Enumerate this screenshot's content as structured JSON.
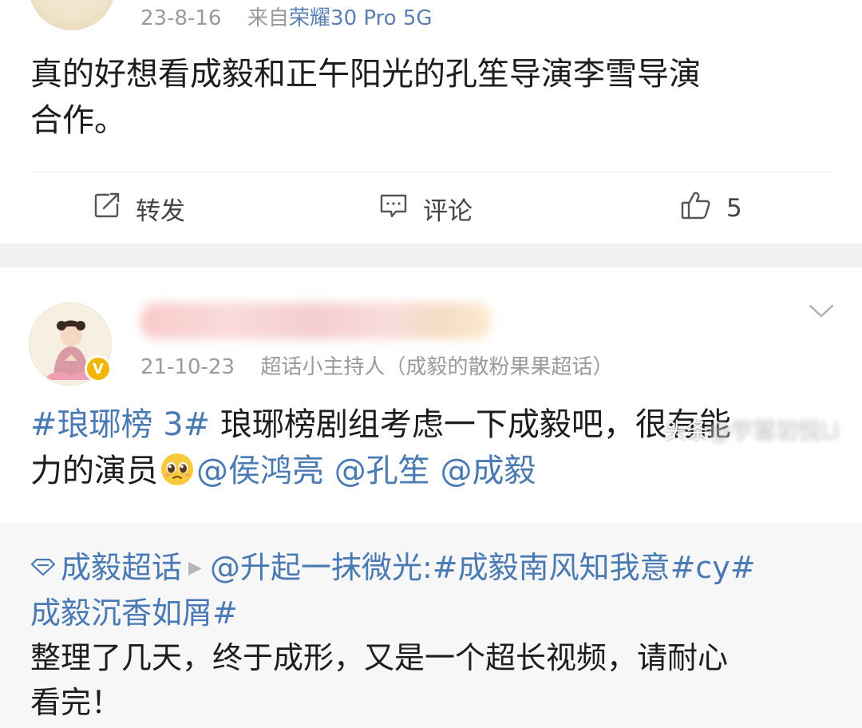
{
  "post1": {
    "date": "23-8-16",
    "source_prefix": "来自",
    "device": "荣耀30 Pro 5G",
    "content_line1": "真的好想看成毅和正午阳光的孔笙导演李雪导演",
    "content_line2": "合作。",
    "actions": {
      "repost_label": "转发",
      "comment_label": "评论",
      "like_count": "5"
    }
  },
  "post2": {
    "date": "21-10-23",
    "role": "超话小主持人（成毅的散粉果果超话）",
    "badge": "V",
    "content": {
      "hashtag": "#琅琊榜 3#",
      "text1": " 琅琊榜剧组考虑一下成毅吧，很有能",
      "text2": "力的演员",
      "mentions": [
        "@侯鸿亮",
        "@孔笙",
        "@成毅"
      ]
    },
    "quote": {
      "supertopic": "成毅超话",
      "line1_link": "@升起一抹微光:#成毅南风知我意#cy#",
      "line2_link": "成毅沉香如屑#",
      "line3": "整理了几天，终于成形，又是一个超长视频，请耐心",
      "line4": "看完！"
    }
  },
  "watermark": {
    "prefix": "头条",
    "handle": "@宇慧初悦Li"
  },
  "colors": {
    "link": "#4a7ab4",
    "meta": "#9a9a9a",
    "gap": "#f1f1f1",
    "quote_bg": "#f7f7f7",
    "badge": "#f2b705"
  },
  "icons": {
    "repost": "share-icon",
    "comment": "comment-icon",
    "like": "thumbs-up-icon",
    "more": "chevron-down-icon",
    "supertopic": "diamond-icon",
    "triangle": "triangle-right-icon",
    "emoji": "pleading-face-emoji"
  }
}
